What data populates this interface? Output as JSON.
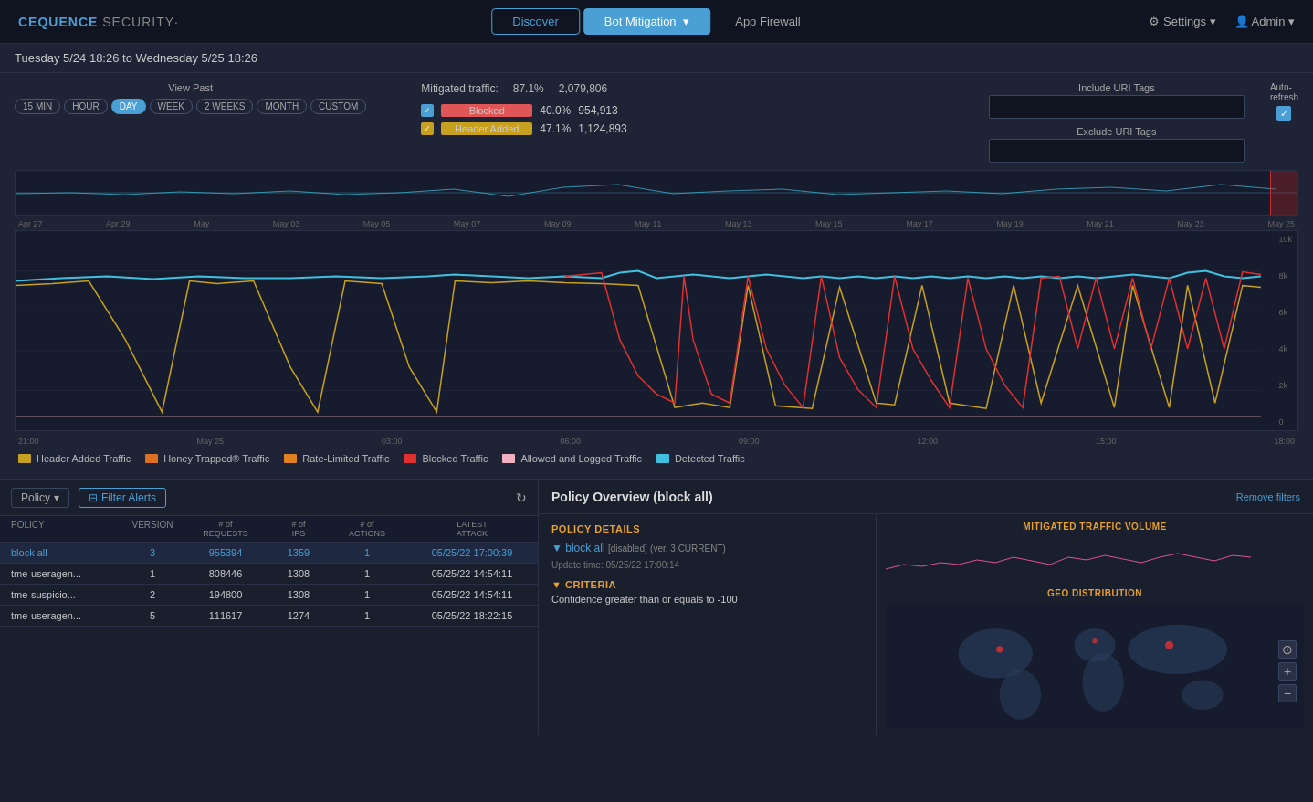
{
  "header": {
    "logo_cequence": "CEQUENCE",
    "logo_security": "SECURITY·",
    "nav": {
      "discover": "Discover",
      "bot_mitigation": "Bot Mitigation",
      "bot_mitigation_arrow": "▾",
      "app_firewall": "App Firewall"
    },
    "settings": "⚙ Settings ▾",
    "admin": "👤 Admin ▾"
  },
  "date_range": "Tuesday 5/24 18:26 to Wednesday 5/25 18:26",
  "view_past": {
    "label": "View Past",
    "buttons": [
      "15 MIN",
      "HOUR",
      "DAY",
      "WEEK",
      "2 WEEKS",
      "MONTH",
      "CUSTOM"
    ],
    "active": "DAY"
  },
  "traffic_stats": {
    "mitigated_label": "Mitigated traffic:",
    "mitigated_pct": "87.1%",
    "mitigated_count": "2,079,806",
    "blocked_label": "Blocked",
    "blocked_pct": "40.0%",
    "blocked_count": "954,913",
    "header_added_label": "Header Added",
    "header_added_pct": "47.1%",
    "header_added_count": "1,124,893"
  },
  "uri_tags": {
    "include_label": "Include URI Tags",
    "exclude_label": "Exclude URI Tags"
  },
  "auto_refresh": {
    "label": "Auto-\nrefresh"
  },
  "mini_chart_dates": [
    "Apr 27",
    "Apr 29",
    "May",
    "May 03",
    "May 05",
    "May 07",
    "May 09",
    "May 11",
    "May 13",
    "May 15",
    "May 17",
    "May 19",
    "May 21",
    "May 23",
    "May 25"
  ],
  "main_chart_x": [
    "21:00",
    "May 25",
    "03:00",
    "06:00",
    "09:00",
    "12:00",
    "15:00",
    "18:00"
  ],
  "main_chart_y": [
    "10k",
    "8k",
    "6k",
    "4k",
    "2k",
    "0"
  ],
  "chart_legend": [
    {
      "label": "Header Added Traffic",
      "color": "#c8a020"
    },
    {
      "label": "Honey Trapped® Traffic",
      "color": "#e07020"
    },
    {
      "label": "Rate-Limited Traffic",
      "color": "#e08020"
    },
    {
      "label": "Blocked Traffic",
      "color": "#e03030"
    },
    {
      "label": "Allowed and Logged Traffic",
      "color": "#f0b0c0"
    },
    {
      "label": "Detected Traffic",
      "color": "#40c0e0"
    }
  ],
  "policy_panel": {
    "title": "Policy",
    "filter_label": "Filter Alerts",
    "columns": [
      "POLICY",
      "VERSION",
      "# of\nREQUESTS",
      "# of\nIPS",
      "# of\nACTIONS",
      "LATEST\nATTACK"
    ],
    "rows": [
      {
        "policy": "block all",
        "version": "3",
        "requests": "955394",
        "ips": "1359",
        "actions": "1",
        "latest": "05/25/22 17:00:39",
        "highlight": true
      },
      {
        "policy": "tme-useragen...",
        "version": "1",
        "requests": "808446",
        "ips": "1308",
        "actions": "1",
        "latest": "05/25/22 14:54:11"
      },
      {
        "policy": "tme-suspicio...",
        "version": "2",
        "requests": "194800",
        "ips": "1308",
        "actions": "1",
        "latest": "05/25/22 14:54:11"
      },
      {
        "policy": "tme-useragen...",
        "version": "5",
        "requests": "111617",
        "ips": "1274",
        "actions": "1",
        "latest": "05/25/22 18:22:15"
      }
    ]
  },
  "right_panel": {
    "title": "Policy Overview (block all)",
    "remove_filters": "Remove filters",
    "policy_details_title": "POLICY DETAILS",
    "block_all_label": "▼ block all",
    "block_all_status": "[disabled]",
    "block_all_version": "(ver. 3 CURRENT)",
    "update_time": "Update time: 05/25/22 17:00:14",
    "criteria_title": "▼ CRITERIA",
    "criteria_text": "Confidence greater than or equals to -100",
    "mitigated_traffic_title": "MITIGATED TRAFFIC VOLUME",
    "geo_distribution_title": "GEO DISTRIBUTION"
  }
}
